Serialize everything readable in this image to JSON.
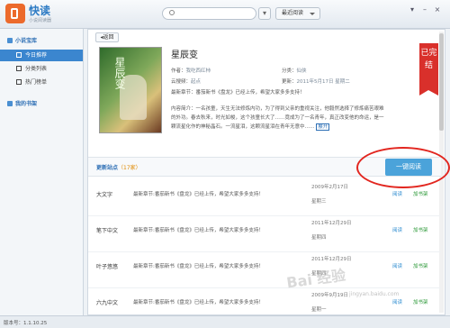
{
  "app": {
    "name": "快读",
    "subtitle": "小说阅读器"
  },
  "header": {
    "recent_label": "最近阅读",
    "search_value": ""
  },
  "sidebar": {
    "library_title": "小说宝库",
    "items": [
      {
        "label": "今日推荐",
        "active": true
      },
      {
        "label": "分类列表",
        "active": false
      },
      {
        "label": "热门榜单",
        "active": false
      }
    ],
    "shelf_title": "我的书架"
  },
  "main": {
    "back_label": "返回",
    "book": {
      "title": "星辰变",
      "cover_text": "星辰变",
      "author_label": "作者：",
      "author": "我吃西红柿",
      "category_label": "分类：",
      "category": "仙侠",
      "platform_label": "云搜频：",
      "platform": "起点",
      "update_label": "更新：",
      "update": "2011年5月17日 星期二",
      "latest_label": "最新章节：",
      "latest": "番茄新书《盘龙》已经上传，希望大家多多支持！",
      "status": "已完结",
      "intro_label": "内容简介：",
      "intro": "一名孩童，天生无法修炼内功，为了得到父亲的重视关注，他毅然选择了修炼痛苦艰难的外功。春去秋来，时光如梭，这个孩童长大了……竟成为了一名青年，真正改变他的命运，是一颗流星化作的神秘晶石。一流星泪，这颗流星泪在青年无意中……",
      "more_label": "展开"
    },
    "sites": {
      "title": "更新站点",
      "count": "（17家）",
      "read_button": "一键阅读",
      "rows": [
        {
          "site": "大文字",
          "update": "最新章节:番茄新书《盘龙》已经上传，希望大家多多支持！",
          "date": "2009年2月17日",
          "weekday": "星期三",
          "read": "阅读",
          "add": "加书架"
        },
        {
          "site": "笔下中文",
          "update": "最新章节:番茄新书《盘龙》已经上传，希望大家多多支持！",
          "date": "2011年12月29日",
          "weekday": "星期四",
          "read": "阅读",
          "add": "加书架"
        },
        {
          "site": "叶子悠悠",
          "update": "最新章节:番茄新书《盘龙》已经上传，希望大家多多支持！",
          "date": "2011年12月29日",
          "weekday": "星期四",
          "read": "阅读",
          "add": "加书架"
        },
        {
          "site": "六九中文",
          "update": "最新章节:番茄新书《盘龙》已经上传，希望大家多多支持！",
          "date": "2009年9月19日",
          "weekday": "星期一",
          "read": "阅读",
          "add": "加书架"
        }
      ]
    }
  },
  "status": {
    "version": "版本号：1.1.10.25"
  },
  "watermark": {
    "text": "Bai 经验",
    "url": "jingyan.baidu.com"
  },
  "colors": {
    "accent": "#3b86cf",
    "read_button": "#4ba3da",
    "ribbon": "#d9302b",
    "annotation": "#e2261f"
  }
}
